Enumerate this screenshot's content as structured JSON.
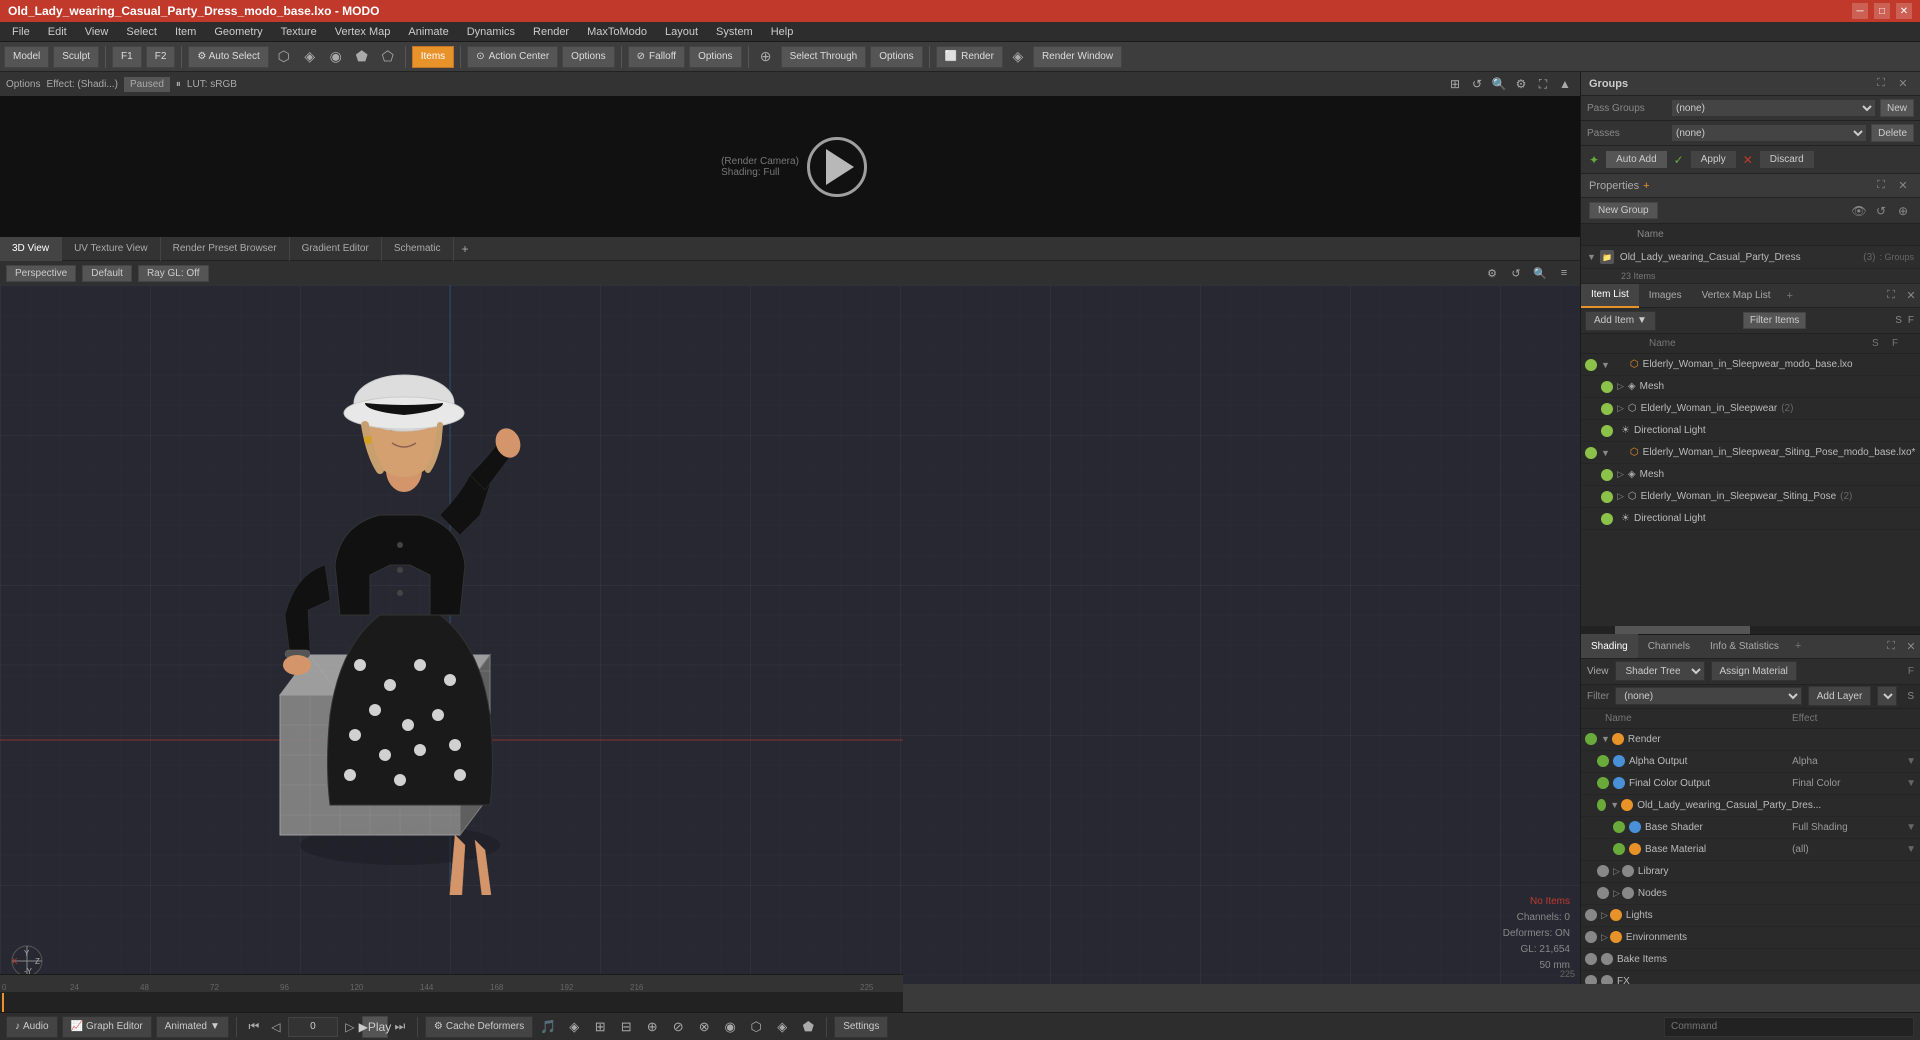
{
  "titleBar": {
    "title": "Old_Lady_wearing_Casual_Party_Dress_modo_base.lxo - MODO",
    "winButtons": [
      "minimize",
      "maximize",
      "close"
    ]
  },
  "menuBar": {
    "items": [
      "File",
      "Edit",
      "View",
      "Select",
      "Item",
      "Geometry",
      "Texture",
      "Vertex Map",
      "Animate",
      "Dynamics",
      "Render",
      "MaxToModo",
      "Layout",
      "System",
      "Help"
    ]
  },
  "toolbar": {
    "modeButtons": [
      "Model",
      "Sculpt"
    ],
    "rightButtons": [
      "Auto Select",
      "Select",
      "Action Center",
      "Options",
      "Falloff",
      "Options"
    ],
    "selectLabel": "Select",
    "itemsLabel": "Items",
    "actionCenterLabel": "Action Center",
    "falloffLabel": "Falloff",
    "renderLabel": "Render",
    "renderWindowLabel": "Render Window",
    "selectThroughLabel": "Select Through"
  },
  "previewPanel": {
    "effectLabel": "Effect: (Shadi...)",
    "pausedLabel": "Paused",
    "lutLabel": "LUT: sRGB",
    "cameraLabel": "(Render Camera)",
    "shadingLabel": "Shading: Full"
  },
  "viewportTabs": {
    "tabs": [
      "3D View",
      "UV Texture View",
      "Render Preset Browser",
      "Gradient Editor",
      "Schematic"
    ],
    "activeTab": "3D View",
    "addTabLabel": "+"
  },
  "viewport3D": {
    "perspectiveLabel": "Perspective",
    "defaultLabel": "Default",
    "rayGLLabel": "Ray GL: Off",
    "info": {
      "noItems": "No Items",
      "channels": "Channels: 0",
      "deformers": "Deformers: ON",
      "gl": "GL: 21,654",
      "mm": "50 mm"
    }
  },
  "groupsPanel": {
    "title": "Groups",
    "newGroupLabel": "New Group",
    "nameHeader": "Name",
    "groups": [
      {
        "name": "Old_Lady_wearing_Casual_Party_Dress",
        "count": "(3)",
        "tag": ": Group",
        "subItems": [
          "23 Items"
        ],
        "expanded": true
      }
    ]
  },
  "passGroups": {
    "passGroupsLabel": "Pass Groups",
    "passGroupsValue": "(none)",
    "passesLabel": "Passes",
    "passesValue": "(none)",
    "newLabel": "New",
    "deleteLabel": "Delete"
  },
  "autoAddBar": {
    "autoAddLabel": "Auto Add",
    "applyLabel": "Apply",
    "discardLabel": "Discard",
    "propertiesLabel": "Properties"
  },
  "itemList": {
    "tabs": [
      "Item List",
      "Images",
      "Vertex Map List"
    ],
    "activeTab": "Item List",
    "addItemLabel": "Add Item",
    "filterLabel": "Filter Items",
    "columns": [
      "",
      "",
      "Name",
      "S",
      "F"
    ],
    "items": [
      {
        "level": 1,
        "name": "Elderly_Woman_in_Sleepwear_modo_base.lxo",
        "type": "file",
        "expanded": true
      },
      {
        "level": 2,
        "name": "Mesh",
        "type": "mesh",
        "expanded": false
      },
      {
        "level": 2,
        "name": "Elderly_Woman_in_Sleepwear",
        "type": "group",
        "count": "(2)",
        "expanded": false
      },
      {
        "level": 2,
        "name": "Directional Light",
        "type": "light",
        "expanded": false
      },
      {
        "level": 1,
        "name": "Elderly_Woman_in_Sleepwear_Siting_Pose_modo_base.lxo*",
        "type": "file",
        "expanded": true
      },
      {
        "level": 2,
        "name": "Mesh",
        "type": "mesh",
        "expanded": false
      },
      {
        "level": 2,
        "name": "Elderly_Woman_in_Sleepwear_Siting_Pose",
        "type": "group",
        "count": "(2)",
        "expanded": false
      },
      {
        "level": 2,
        "name": "Directional Light",
        "type": "light",
        "expanded": false
      }
    ]
  },
  "shadingPanel": {
    "tabs": [
      "Shading",
      "Channels",
      "Info & Statistics"
    ],
    "activeTab": "Shading",
    "addTabLabel": "+",
    "viewLabel": "View",
    "viewValue": "Shader Tree",
    "assignMaterialLabel": "Assign Material",
    "filterLabel": "Filter",
    "filterValue": "(none)",
    "addLayerLabel": "Add Layer",
    "fLabel": "F",
    "sLabel": "S",
    "columns": [
      "",
      "Name",
      "Effect"
    ],
    "items": [
      {
        "level": 0,
        "name": "Render",
        "type": "render",
        "effect": "",
        "icon": "orange",
        "expanded": true
      },
      {
        "level": 1,
        "name": "Alpha Output",
        "type": "output",
        "effect": "Alpha",
        "icon": "blue"
      },
      {
        "level": 1,
        "name": "Final Color Output",
        "type": "output",
        "effect": "Final Color",
        "icon": "blue"
      },
      {
        "level": 1,
        "name": "Old_Lady_wearing_Casual_Party_Dres...",
        "type": "material",
        "effect": "",
        "icon": "orange",
        "expanded": true
      },
      {
        "level": 2,
        "name": "Base Shader",
        "type": "shader",
        "effect": "Full Shading",
        "icon": "blue"
      },
      {
        "level": 2,
        "name": "Base Material",
        "type": "material",
        "effect": "(all)",
        "icon": "orange"
      },
      {
        "level": 1,
        "name": "Library",
        "type": "library",
        "effect": "",
        "icon": "gray",
        "expanded": false
      },
      {
        "level": 1,
        "name": "Nodes",
        "type": "nodes",
        "effect": "",
        "icon": "gray",
        "expanded": false
      },
      {
        "level": 0,
        "name": "Lights",
        "type": "lights",
        "effect": "",
        "icon": "orange",
        "expanded": false
      },
      {
        "level": 0,
        "name": "Environments",
        "type": "environments",
        "effect": "",
        "icon": "orange",
        "expanded": false
      },
      {
        "level": 0,
        "name": "Bake Items",
        "type": "bake",
        "effect": "",
        "icon": "gray"
      },
      {
        "level": 0,
        "name": "FX",
        "type": "fx",
        "effect": "",
        "icon": "gray"
      }
    ]
  },
  "bottomBar": {
    "audioLabel": "Audio",
    "graphEditorLabel": "Graph Editor",
    "animatedLabel": "Animated",
    "playLabel": "Play",
    "cacheDeformersLabel": "Cache Deformers",
    "settingsLabel": "Settings",
    "commandLabel": "Command",
    "timeValue": "0"
  },
  "timeline": {
    "marks": [
      "0",
      "24",
      "48",
      "72",
      "96",
      "120",
      "144",
      "168",
      "192",
      "216"
    ],
    "endMark": "225"
  }
}
